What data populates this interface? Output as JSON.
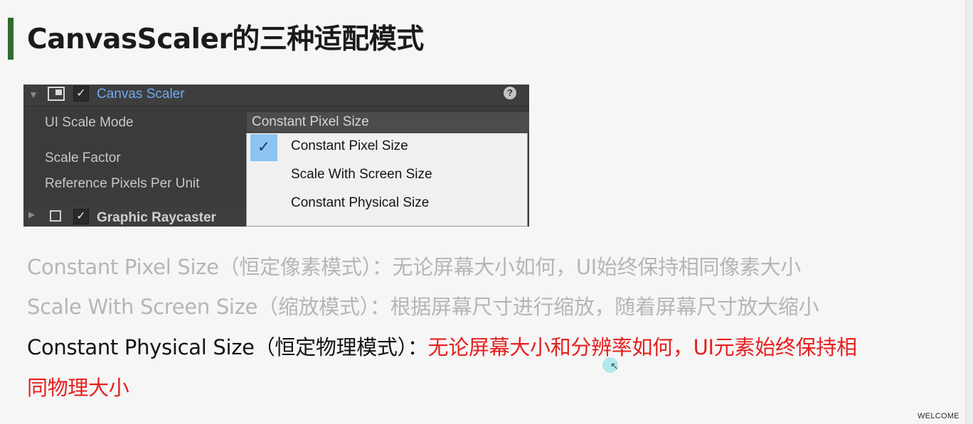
{
  "slide": {
    "title": "CanvasScaler的三种适配模式",
    "footer": "WELCOME"
  },
  "inspector": {
    "component_name": "Canvas Scaler",
    "help_glyph": "?",
    "check_glyph": "✓",
    "fold_glyph": "▼",
    "properties": {
      "ui_scale_mode_label": "UI Scale Mode",
      "scale_factor_label": "Scale Factor",
      "reference_pixels_label": "Reference Pixels Per Unit"
    },
    "dropdown": {
      "selected": "Constant Pixel Size",
      "options": [
        {
          "label": "Constant Pixel Size",
          "checked": true
        },
        {
          "label": "Scale With Screen Size",
          "checked": false
        },
        {
          "label": "Constant Physical Size",
          "checked": false
        }
      ]
    },
    "next_component": {
      "fold_glyph": "▶",
      "name": "Graphic Raycaster"
    }
  },
  "descriptions": [
    {
      "mode": "Constant Pixel Size",
      "cn_paren": "（恒定像素模式）：",
      "text": "无论屏幕大小如何，UI始终保持相同像素大小"
    },
    {
      "mode": "Scale With Screen Size",
      "cn_paren": "（缩放模式）：",
      "text": "根据屏幕尺寸进行缩放，随着屏幕尺寸放大缩小"
    },
    {
      "mode": "Constant Physical Size",
      "cn_paren": "（恒定物理模式）：",
      "text_line1": "无论屏幕大小和分辨率如何，UI元素始终保持相",
      "text_line2": "同物理大小"
    }
  ],
  "colors": {
    "title_accent": "#2e6b2e",
    "highlight_red": "#e5201f",
    "muted_gray": "#b6b6b6",
    "unity_blue": "#6eaaf3"
  }
}
